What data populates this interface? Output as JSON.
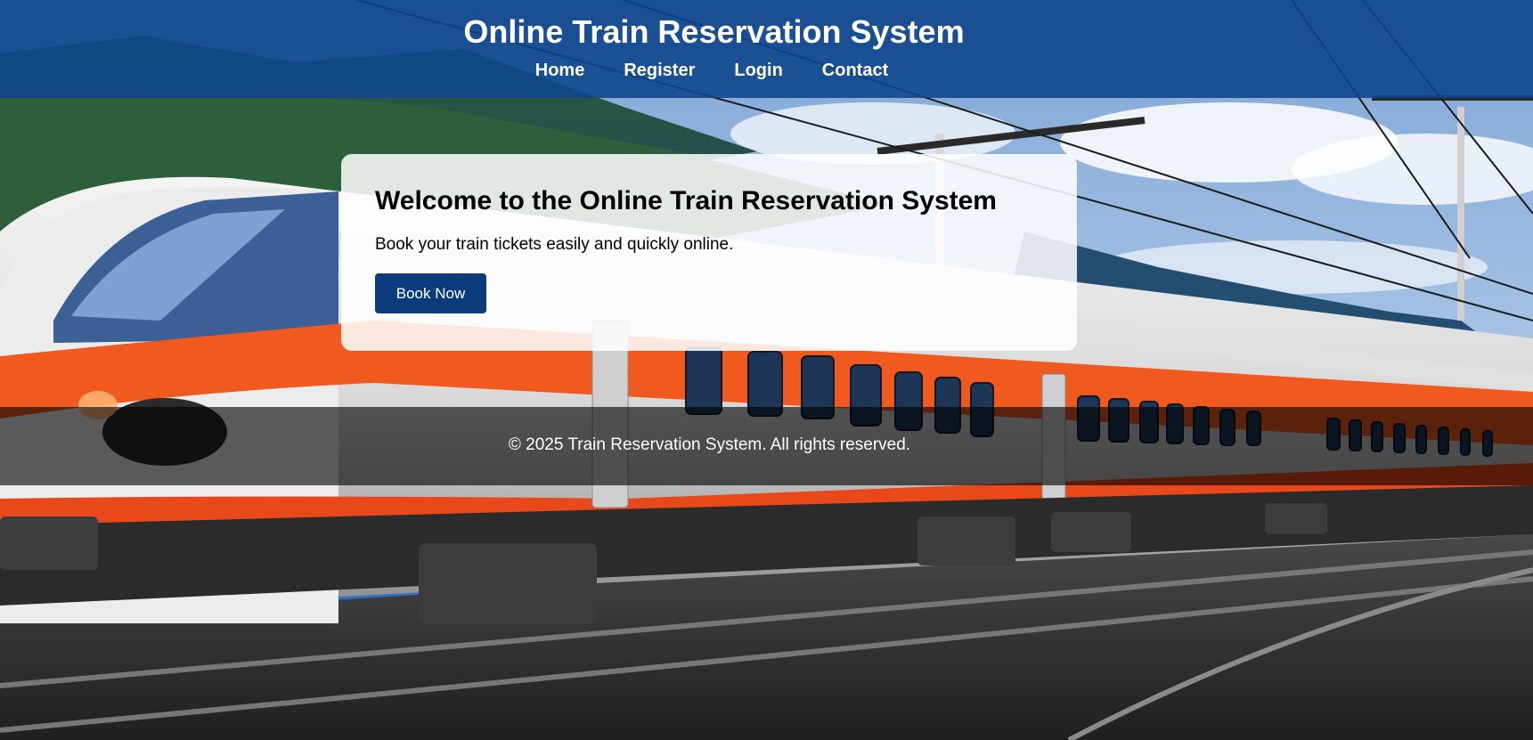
{
  "header": {
    "title": "Online Train Reservation System",
    "nav": [
      "Home",
      "Register",
      "Login",
      "Contact"
    ]
  },
  "welcome": {
    "title": "Welcome to the Online Train Reservation System",
    "text": "Book your train tickets easily and quickly online.",
    "button_label": "Book Now"
  },
  "footer": {
    "text": "© 2025 Train Reservation System. All rights reserved."
  },
  "background": {
    "image": "high-speed-train-photo",
    "train_livery": "InterCity"
  },
  "colors": {
    "header_bg": "#0e468c",
    "button_bg": "#0b3b7c",
    "train_orange": "#f05a1e",
    "sky": "#5d91d0"
  }
}
